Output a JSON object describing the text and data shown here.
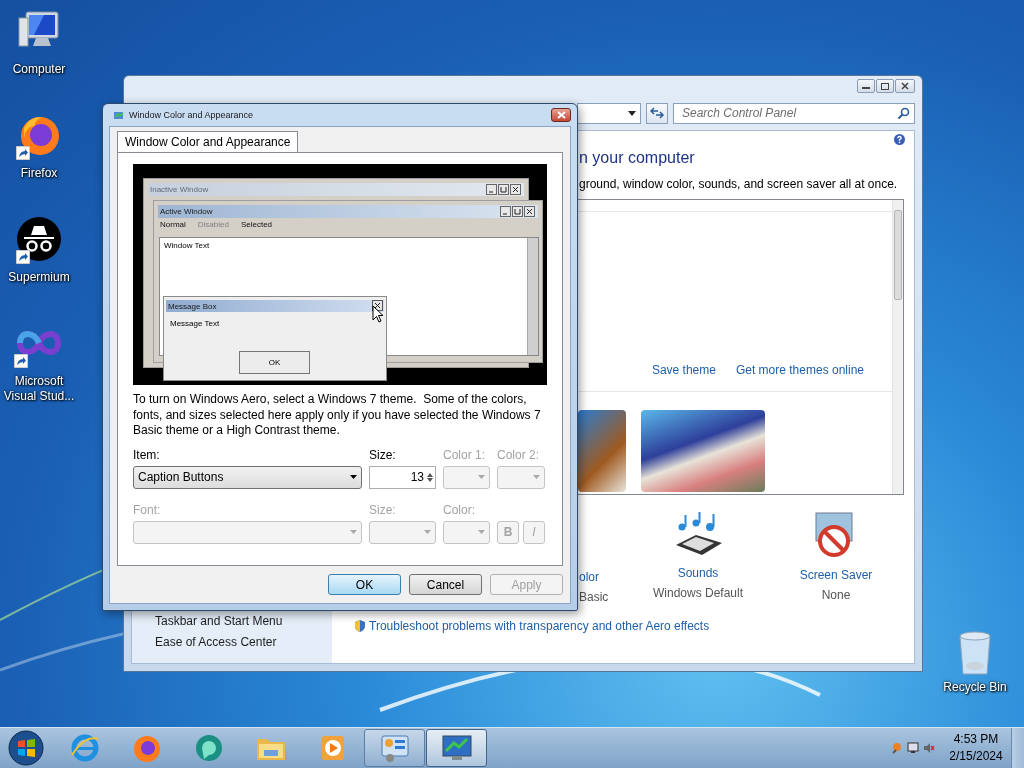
{
  "desktop_icons": [
    {
      "kind": "computer",
      "label": "Computer",
      "shortcut": false
    },
    {
      "kind": "firefox",
      "label": "Firefox",
      "shortcut": true
    },
    {
      "kind": "incognito",
      "label": "Supermium",
      "shortcut": true
    },
    {
      "kind": "infinity",
      "label": "Microsoft Visual Stud...",
      "shortcut": true
    }
  ],
  "recycle_bin": {
    "label": "Recycle Bin"
  },
  "control_panel": {
    "search": {
      "placeholder": "Search Control Panel"
    },
    "heading": "n your computer",
    "description": "ground, window color, sounds, and screen saver all at once.",
    "theme_links": [
      "Save theme",
      "Get more themes online"
    ],
    "settings": [
      {
        "kind": "color",
        "title": "olor",
        "value": "Basic"
      },
      {
        "kind": "sounds",
        "title": "Sounds",
        "value": "Windows Default"
      },
      {
        "kind": "screensaver",
        "title": "Screen Saver",
        "value": "None"
      }
    ],
    "sidebar_links": [
      "Taskbar and Start Menu",
      "Ease of Access Center"
    ],
    "troubleshoot_link": "Troubleshoot problems with transparency and other Aero effects"
  },
  "dialog": {
    "title": "Window Color and Appearance",
    "tabs": [
      {
        "label": "Window Color and Appearance",
        "selected": true
      }
    ],
    "preview": {
      "inactive_title": "Inactive Window",
      "active_title": "Active Window",
      "menu": [
        {
          "label": "Normal",
          "disabled": false
        },
        {
          "label": "Disabled",
          "disabled": true
        },
        {
          "label": "Selected",
          "disabled": false
        }
      ],
      "window_text": "Window Text",
      "message_title": "Message Box",
      "message_text": "Message Text",
      "message_button": "OK"
    },
    "info": "To turn on Windows Aero, select a Windows 7 theme.  Some of the colors, fonts, and sizes selected here apply only if you have selected the Windows 7 Basic theme or a High Contrast theme.",
    "rows": [
      [
        {
          "kind": "select",
          "label": "Item:",
          "value": "Caption Buttons",
          "disabled": false
        },
        {
          "kind": "spin",
          "label": "Size:",
          "value": "13",
          "disabled": false
        },
        {
          "kind": "color",
          "label": "Color 1:",
          "disabled": true
        },
        {
          "kind": "color",
          "label": "Color 2:",
          "disabled": true
        }
      ],
      [
        {
          "kind": "select",
          "label": "Font:",
          "disabled": true
        },
        {
          "kind": "select",
          "label": "Size:",
          "disabled": true
        },
        {
          "kind": "color",
          "label": "Color:",
          "disabled": true
        },
        {
          "kind": "style",
          "buttons": [
            "B",
            "I"
          ],
          "disabled": true
        }
      ]
    ],
    "buttons": [
      {
        "label": "OK",
        "default": true,
        "disabled": false
      },
      {
        "label": "Cancel",
        "default": false,
        "disabled": false
      },
      {
        "label": "Apply",
        "default": false,
        "disabled": true
      }
    ]
  },
  "taskbar": {
    "apps": [
      {
        "kind": "ie",
        "open": false,
        "active": false
      },
      {
        "kind": "firefox",
        "open": false,
        "active": false
      },
      {
        "kind": "teal",
        "open": false,
        "active": false
      },
      {
        "kind": "explorer",
        "open": false,
        "active": false
      },
      {
        "kind": "media",
        "open": false,
        "active": false
      },
      {
        "kind": "control-panel",
        "open": true,
        "active": false
      },
      {
        "kind": "display",
        "open": true,
        "active": true
      }
    ],
    "clock": {
      "time": "4:53 PM",
      "date": "2/15/2024"
    }
  }
}
